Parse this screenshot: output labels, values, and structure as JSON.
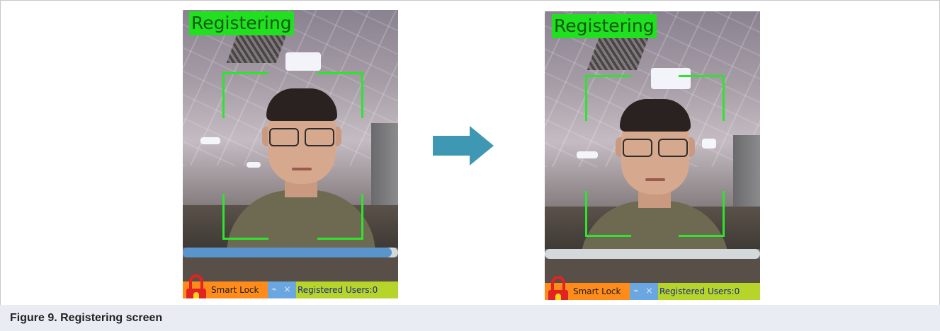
{
  "figure": {
    "caption": "Figure 9.  Registering screen"
  },
  "screens": [
    {
      "status_label": "Registering",
      "progress": 0.97,
      "progress_color": "#5a94cc",
      "app_title": "Smart Lock",
      "users_text": "Registered Users:0"
    },
    {
      "status_label": "Registering",
      "progress": 0.0,
      "progress_color": "#5a94cc",
      "app_title": "Smart Lock",
      "users_text": "Registered Users:0"
    }
  ],
  "icons": {
    "lock": "lock-icon",
    "wifi": "wifi-off-icon",
    "bluetooth": "bluetooth-off-icon",
    "arrow": "right-arrow-icon"
  },
  "colors": {
    "status_label_bg": "#20e020",
    "bracket": "#2ee42e",
    "app_title_bg": "#ff8c1a",
    "icons_bg": "#6aa7e0",
    "users_bg": "#b7d42a",
    "arrow": "#3e98b4"
  }
}
